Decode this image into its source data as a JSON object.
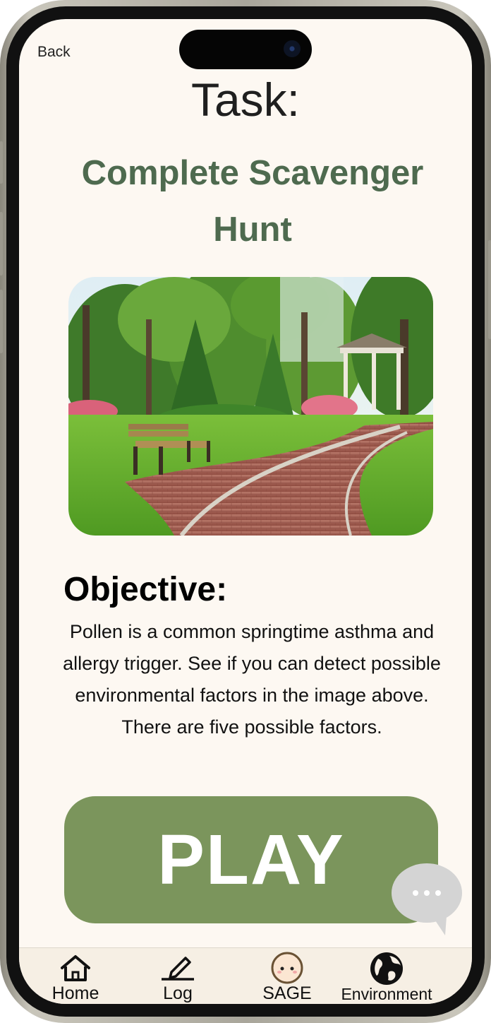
{
  "nav": {
    "back_label": "Back"
  },
  "task": {
    "heading": "Task:",
    "name": "Complete Scavenger Hunt"
  },
  "objective": {
    "heading": "Objective:",
    "text": "Pollen is a common springtime asthma and allergy trigger.  See if you can detect possible environmental factors in the image above. There are five possible factors."
  },
  "play_button": {
    "label": "PLAY"
  },
  "tabbar": {
    "items": [
      {
        "label": "Home",
        "icon": "house-icon"
      },
      {
        "label": "Log",
        "icon": "pencil-icon"
      },
      {
        "label": "SAGE",
        "icon": "sage-face-icon"
      },
      {
        "label": "Environment",
        "icon": "globe-icon"
      }
    ]
  },
  "colors": {
    "screen_bg": "#fdf8f2",
    "task_name": "#4e6a4f",
    "play_button": "#7b955c",
    "tabbar_bg": "#f6efe4"
  }
}
